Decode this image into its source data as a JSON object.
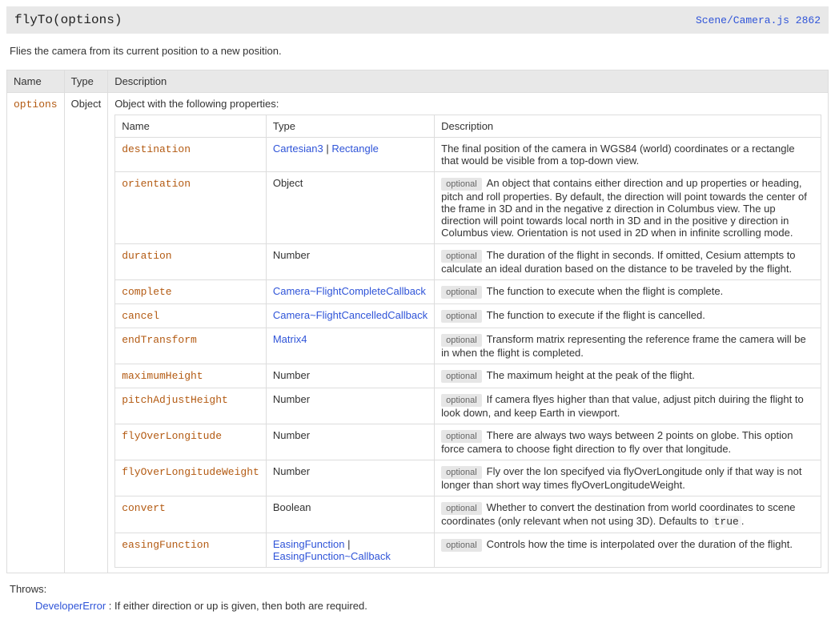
{
  "method_signature": "flyTo(options)",
  "source_link": "Scene/Camera.js 2862",
  "intro": "Flies the camera from its current position to a new position.",
  "outer_headers": {
    "name": "Name",
    "type": "Type",
    "desc": "Description"
  },
  "outer_row": {
    "name": "options",
    "type": "Object",
    "desc_lead": "Object with the following properties:"
  },
  "inner_headers": {
    "name": "Name",
    "type": "Type",
    "desc": "Description"
  },
  "props": [
    {
      "name": "destination",
      "type_html": "<span class='ptype-link' data-name='type-link' data-interactable='true'>Cartesian3</span> | <span class='ptype-link' data-name='type-link' data-interactable='true'>Rectangle</span>",
      "optional": false,
      "desc": "The final position of the camera in WGS84 (world) coordinates or a rectangle that would be visible from a top-down view."
    },
    {
      "name": "orientation",
      "type_html": "Object",
      "optional": true,
      "desc": "An object that contains either direction and up properties or heading, pitch and roll properties. By default, the direction will point towards the center of the frame in 3D and in the negative z direction in Columbus view. The up direction will point towards local north in 3D and in the positive y direction in Columbus view. Orientation is not used in 2D when in infinite scrolling mode."
    },
    {
      "name": "duration",
      "type_html": "Number",
      "optional": true,
      "desc": "The duration of the flight in seconds. If omitted, Cesium attempts to calculate an ideal duration based on the distance to be traveled by the flight."
    },
    {
      "name": "complete",
      "type_html": "<span class='ptype-link' data-name='type-link' data-interactable='true'>Camera~FlightCompleteCallback</span>",
      "optional": true,
      "desc": "The function to execute when the flight is complete."
    },
    {
      "name": "cancel",
      "type_html": "<span class='ptype-link' data-name='type-link' data-interactable='true'>Camera~FlightCancelledCallback</span>",
      "optional": true,
      "desc": "The function to execute if the flight is cancelled."
    },
    {
      "name": "endTransform",
      "type_html": "<span class='ptype-link' data-name='type-link' data-interactable='true'>Matrix4</span>",
      "optional": true,
      "desc": "Transform matrix representing the reference frame the camera will be in when the flight is completed."
    },
    {
      "name": "maximumHeight",
      "type_html": "Number",
      "optional": true,
      "desc": "The maximum height at the peak of the flight."
    },
    {
      "name": "pitchAdjustHeight",
      "type_html": "Number",
      "optional": true,
      "desc": "If camera flyes higher than that value, adjust pitch duiring the flight to look down, and keep Earth in viewport."
    },
    {
      "name": "flyOverLongitude",
      "type_html": "Number",
      "optional": true,
      "desc": "There are always two ways between 2 points on globe. This option force camera to choose fight direction to fly over that longitude."
    },
    {
      "name": "flyOverLongitudeWeight",
      "type_html": "Number",
      "optional": true,
      "desc": "Fly over the lon specifyed via flyOverLongitude only if that way is not longer than short way times flyOverLongitudeWeight."
    },
    {
      "name": "convert",
      "type_html": "Boolean",
      "optional": true,
      "desc": "Whether to convert the destination from world coordinates to scene coordinates (only relevant when not using 3D). Defaults to <span class='code-literal'>true</span>."
    },
    {
      "name": "easingFunction",
      "type_html": "<span class='ptype-link' data-name='type-link' data-interactable='true'>EasingFunction</span> | <span class='ptype-link' data-name='type-link' data-interactable='true'>EasingFunction~Callback</span>",
      "optional": true,
      "desc": "Controls how the time is interpolated over the duration of the flight."
    }
  ],
  "optional_label": "optional",
  "throws": {
    "header": "Throws:",
    "link": "DeveloperError",
    "text": ": If either direction or up is given, then both are required."
  }
}
